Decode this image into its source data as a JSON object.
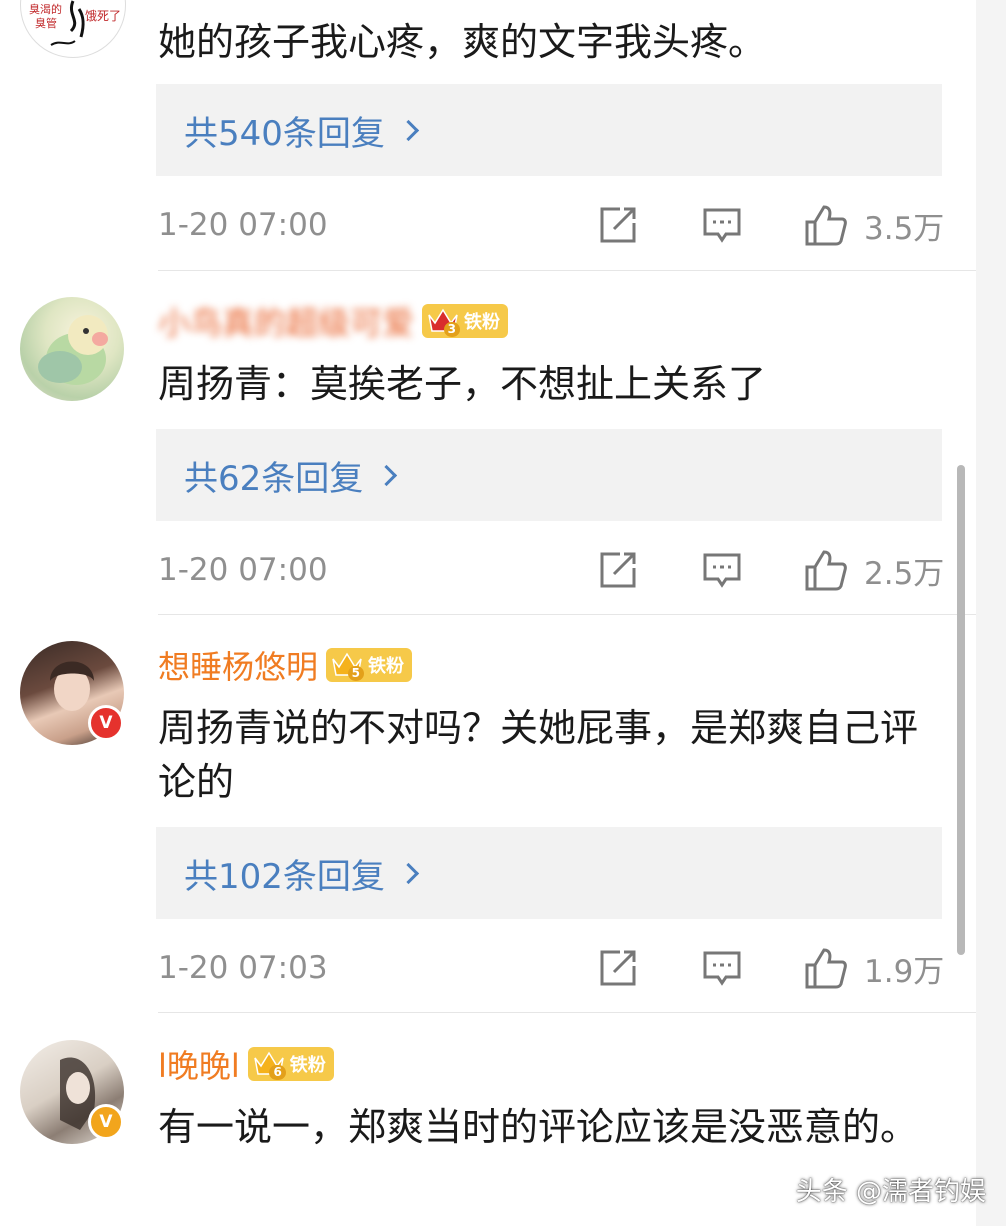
{
  "colors": {
    "username": "#f07c22",
    "reply_link": "#4a7fbf",
    "meta": "#8f8f8f",
    "reply_bg": "#f2f2f2",
    "fan_badge": "#f6c949"
  },
  "comments": [
    {
      "avatar_text": [
        "臭渴的",
        "臭管",
        "饿死了"
      ],
      "text": "她的孩子我心疼，爽的文字我头疼。",
      "reply_label": "共540条回复",
      "time": "1-20 07:00",
      "likes": "3.5万"
    },
    {
      "username": "小鸟真的超级可爱",
      "fan_level": "3",
      "fan_text": "铁粉",
      "text": "周扬青：莫挨老子，不想扯上关系了",
      "reply_label": "共62条回复",
      "time": "1-20 07:00",
      "likes": "2.5万"
    },
    {
      "username": "想睡杨悠明",
      "fan_level": "5",
      "fan_text": "铁粉",
      "verified": "V",
      "text": "周扬青说的不对吗？关她屁事，是郑爽自己评论的",
      "reply_label": "共102条回复",
      "time": "1-20 07:03",
      "likes": "1.9万"
    },
    {
      "username": "l晚晚l",
      "fan_level": "6",
      "fan_text": "铁粉",
      "verified": "V",
      "text": "有一说一，郑爽当时的评论应该是没恶意的。"
    }
  ],
  "watermark": "头条 @濡者钓娱"
}
